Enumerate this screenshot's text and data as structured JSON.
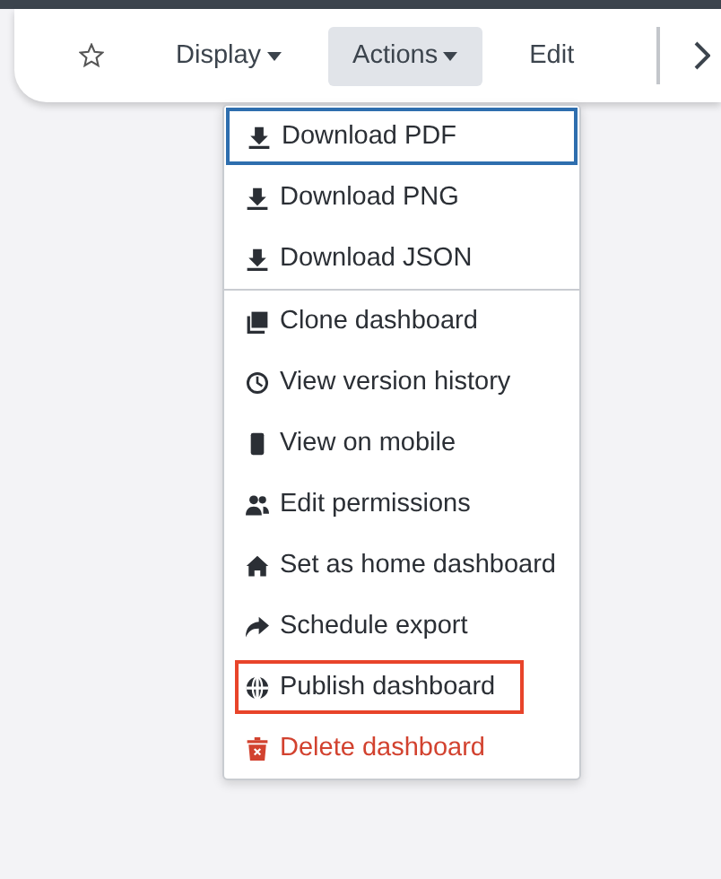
{
  "toolbar": {
    "items": [
      {
        "label": "Display",
        "dropdown": true,
        "selected": false
      },
      {
        "label": "Actions",
        "dropdown": true,
        "selected": true
      },
      {
        "label": "Edit",
        "dropdown": false,
        "selected": false
      }
    ]
  },
  "actions_menu": {
    "groups": [
      [
        {
          "label": "Download PDF",
          "focused": true,
          "highlighted": false,
          "danger": false
        },
        {
          "label": "Download PNG",
          "focused": false,
          "highlighted": false,
          "danger": false
        },
        {
          "label": "Download JSON",
          "focused": false,
          "highlighted": false,
          "danger": false
        }
      ],
      [
        {
          "label": "Clone dashboard",
          "focused": false,
          "highlighted": false,
          "danger": false
        },
        {
          "label": "View version history",
          "focused": false,
          "highlighted": false,
          "danger": false
        },
        {
          "label": "View on mobile",
          "focused": false,
          "highlighted": false,
          "danger": false
        },
        {
          "label": "Edit permissions",
          "focused": false,
          "highlighted": false,
          "danger": false
        },
        {
          "label": "Set as home dashboard",
          "focused": false,
          "highlighted": false,
          "danger": false
        },
        {
          "label": "Schedule export",
          "focused": false,
          "highlighted": false,
          "danger": false
        },
        {
          "label": "Publish dashboard",
          "focused": false,
          "highlighted": true,
          "danger": false
        },
        {
          "label": "Delete dashboard",
          "focused": false,
          "highlighted": false,
          "danger": true
        }
      ]
    ]
  }
}
